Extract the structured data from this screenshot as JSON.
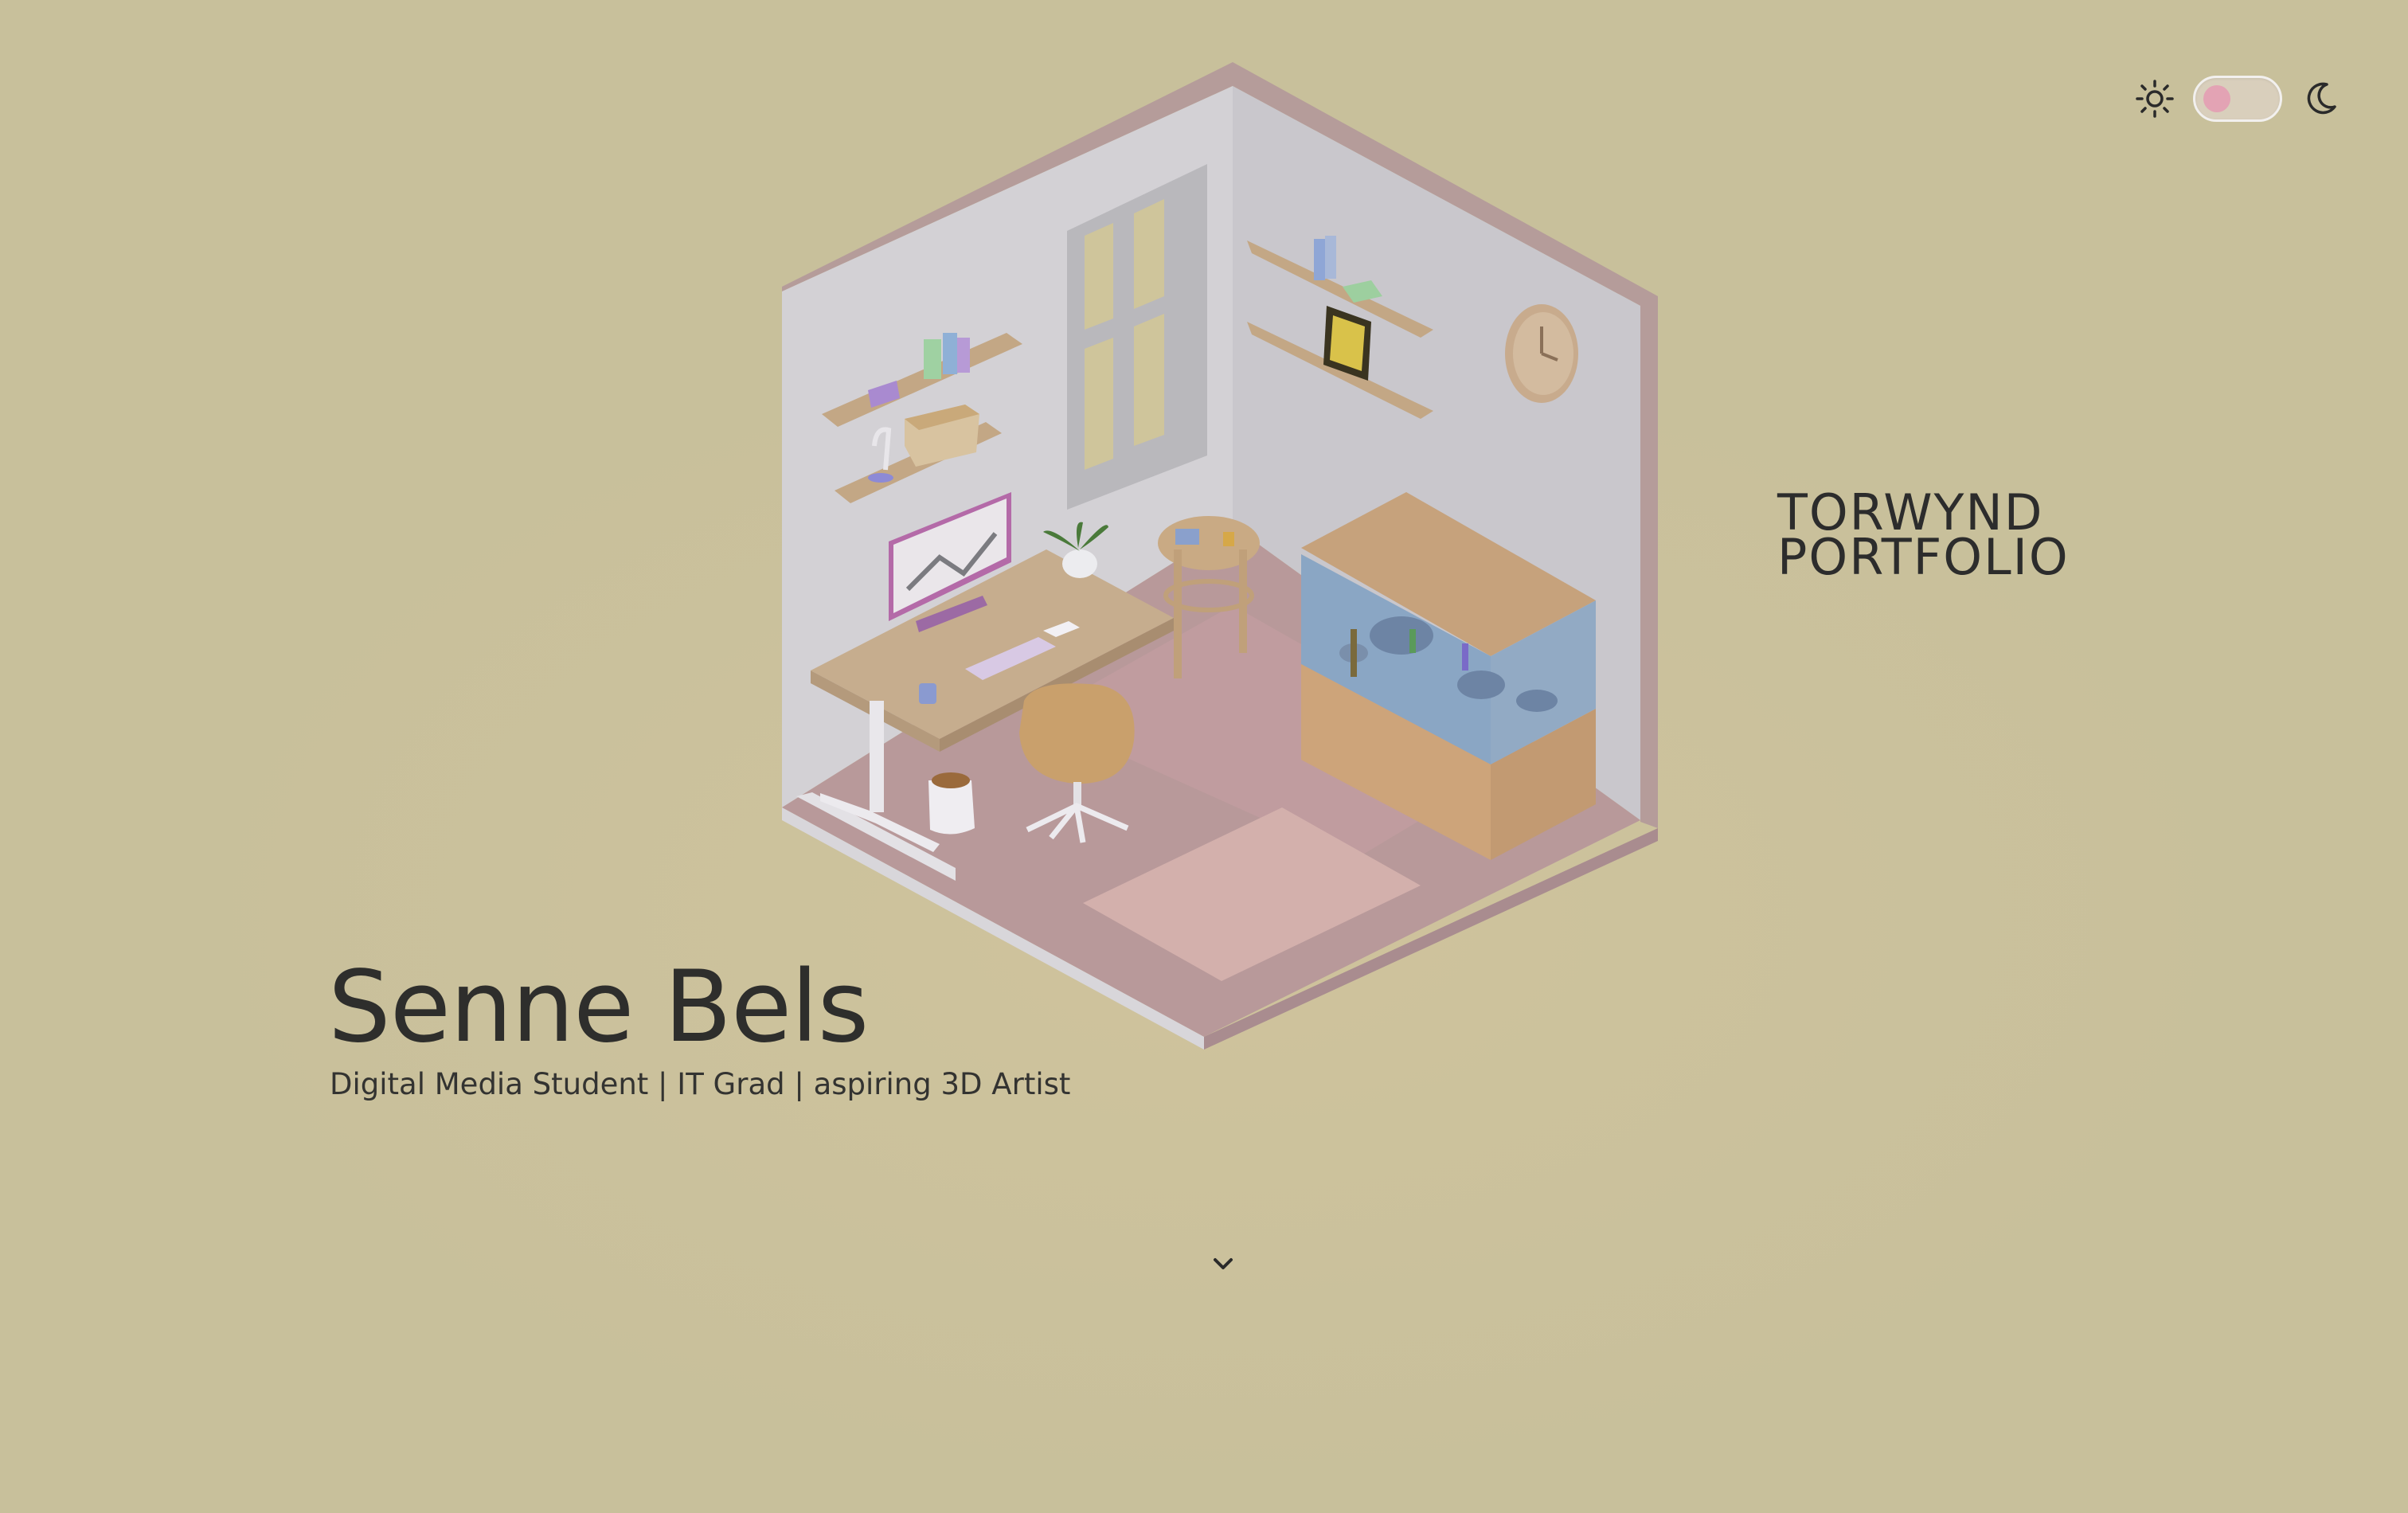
{
  "hero": {
    "name": "Senne Bels",
    "tagline": "Digital Media Student | IT Grad | aspiring 3D Artist"
  },
  "brand": {
    "title": "TORWYND\nPORTFOLIO"
  },
  "theme_toggle": {
    "light_icon": "sun-icon",
    "dark_icon": "moon-icon",
    "mode": "light"
  },
  "scroll": {
    "icon": "chevron-down-icon"
  },
  "colors": {
    "background": "#c8c09b",
    "text": "#2e2e2c",
    "toggle_knob": "#e3a3b4",
    "wall": "#d4d2d6",
    "floor": "#b89c94",
    "wood": "#c7a67c"
  }
}
